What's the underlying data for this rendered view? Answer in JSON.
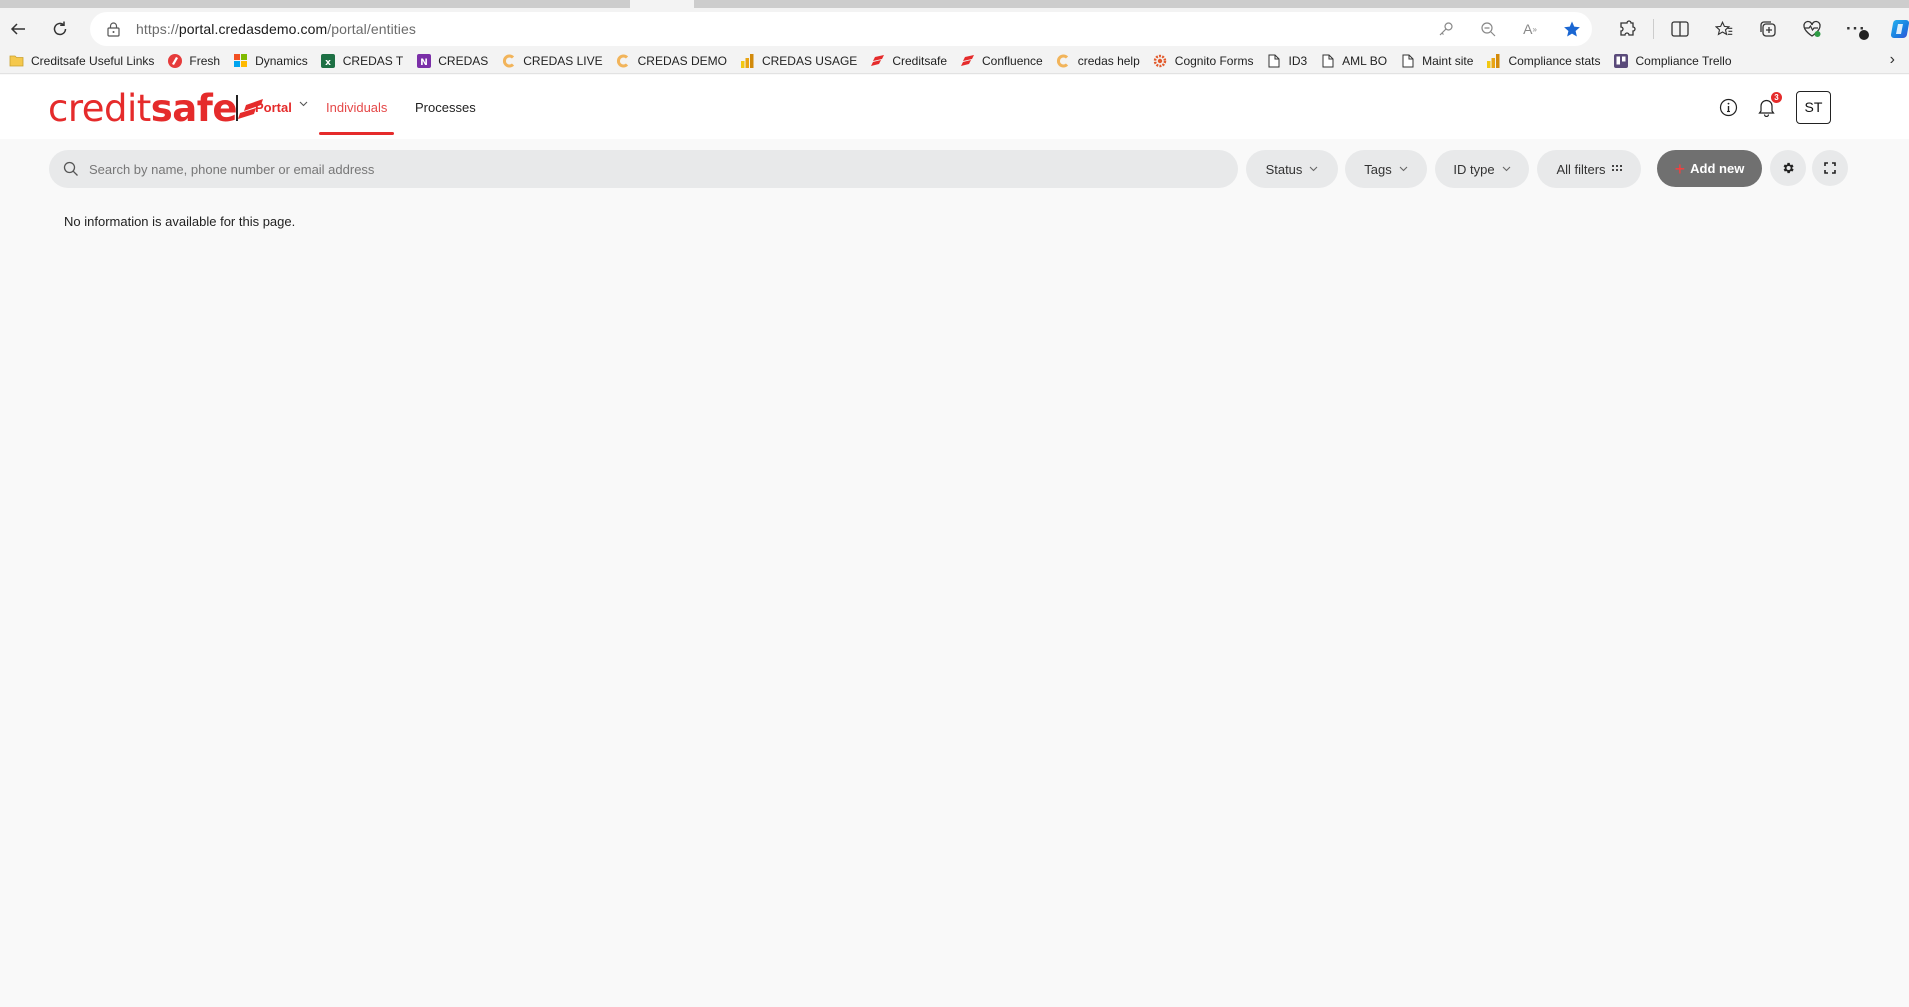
{
  "browser": {
    "url_prefix": "https://",
    "url_host": "portal.credasdemo.com",
    "url_path": "/portal/entities",
    "bookmarks": [
      {
        "label": "Creditsafe Useful Links",
        "icon": "folder-icon"
      },
      {
        "label": "Fresh",
        "icon": "fresh-icon"
      },
      {
        "label": "Dynamics",
        "icon": "microsoft-icon"
      },
      {
        "label": "CREDAS T",
        "icon": "excel-icon"
      },
      {
        "label": "CREDAS",
        "icon": "onenote-icon"
      },
      {
        "label": "CREDAS LIVE",
        "icon": "credas-icon"
      },
      {
        "label": "CREDAS DEMO",
        "icon": "credas-icon"
      },
      {
        "label": "CREDAS USAGE",
        "icon": "powerbi-icon"
      },
      {
        "label": "Creditsafe",
        "icon": "creditsafe-icon"
      },
      {
        "label": "Confluence",
        "icon": "creditsafe-icon"
      },
      {
        "label": "credas help",
        "icon": "credas-icon"
      },
      {
        "label": "Cognito Forms",
        "icon": "cognito-icon"
      },
      {
        "label": "ID3",
        "icon": "page-icon"
      },
      {
        "label": "AML BO",
        "icon": "page-icon"
      },
      {
        "label": "Maint site",
        "icon": "page-icon"
      },
      {
        "label": "Compliance stats",
        "icon": "powerbi-icon"
      },
      {
        "label": "Compliance Trello",
        "icon": "trello-icon"
      }
    ]
  },
  "header": {
    "logo_light": "credit",
    "logo_bold": "safe",
    "nav": {
      "portal": "Portal",
      "individuals": "Individuals",
      "processes": "Processes"
    },
    "notification_count": "3",
    "avatar_initials": "ST"
  },
  "filters": {
    "search_placeholder": "Search by name, phone number or email address",
    "search_value": "",
    "status": "Status",
    "tags": "Tags",
    "id_type": "ID type",
    "all_filters": "All filters",
    "add_new": "Add new"
  },
  "main": {
    "empty_message": "No information is available for this page."
  },
  "colors": {
    "brand": "#e52b2b",
    "add_new_bg": "#707070",
    "chip_bg": "#e8e9ea"
  }
}
